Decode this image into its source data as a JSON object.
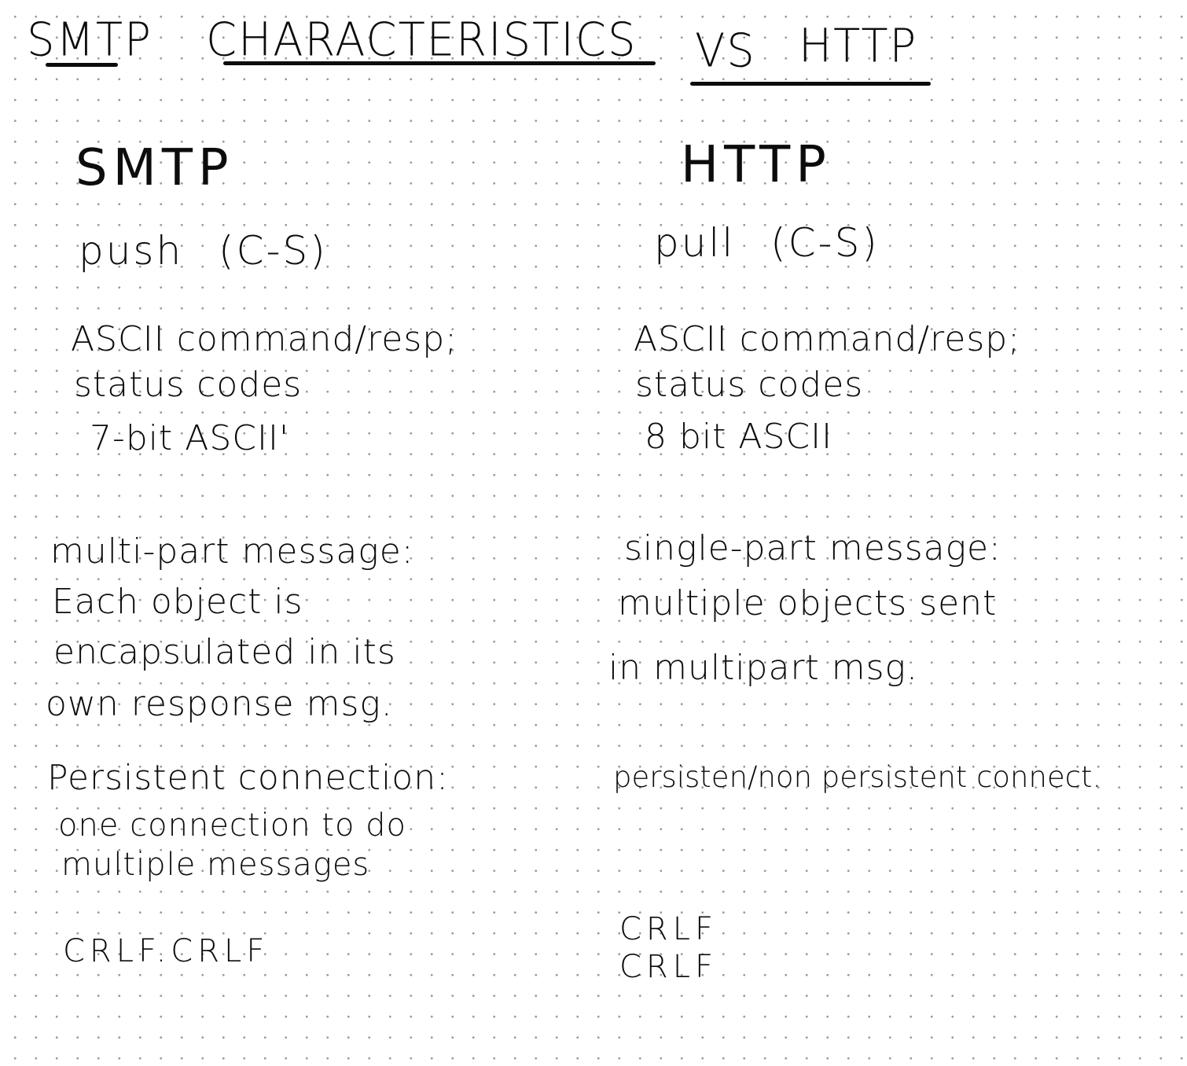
{
  "title": {
    "part1": "SMTP",
    "part2": "CHARACTERISTICS",
    "part3": "VS",
    "part4": "HTTP"
  },
  "smtp": {
    "heading": "SMTP",
    "mode": "push (C-S)",
    "format_line1": "ASCII command/resp;",
    "format_line2": "status codes",
    "encoding": "7-bit ASCII'",
    "message_line1": "multi-part message:",
    "message_line2": "Each object is",
    "message_line3": "encapsulated in its",
    "message_line4": "own response msg.",
    "connection_line1": "Persistent connection:",
    "connection_line2": "one connection to do",
    "connection_line3": "multiple messages",
    "terminator": "CRLF.CRLF"
  },
  "http": {
    "heading": "HTTP",
    "mode": "pull (C-S)",
    "format_line1": "ASCII command/resp;",
    "format_line2": "status codes",
    "encoding": "8 bit ASCII",
    "message_line1": "single-part message:",
    "message_line2": "multiple objects sent",
    "message_line3": "in multipart msg.",
    "connection_line1": "persisten/non persistent connect.",
    "terminator_line1": "CRLF",
    "terminator_line2": "CRLF"
  }
}
